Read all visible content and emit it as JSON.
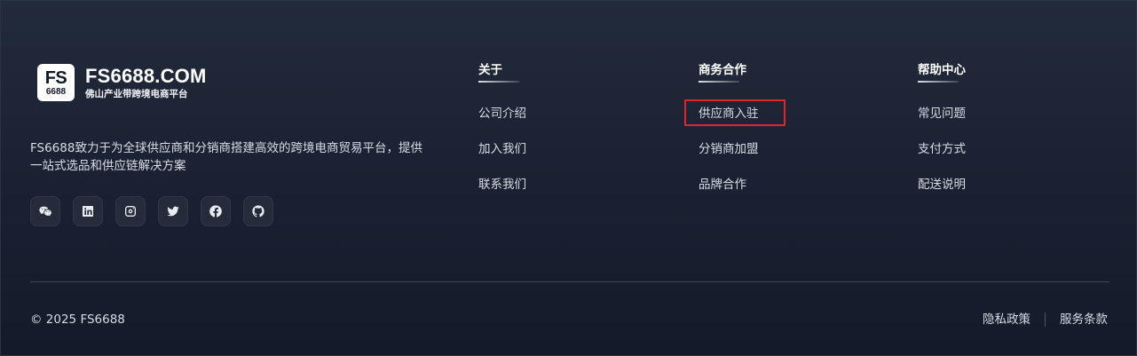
{
  "brand": {
    "logo_line1": "FS",
    "logo_line2": "6688",
    "name": "FS6688.COM",
    "tagline": "佛山产业带跨境电商平台",
    "intro": "FS6688致力于为全球供应商和分销商搭建高效的跨境电商贸易平台，提供一站式选品和供应链解决方案"
  },
  "socials": [
    {
      "icon": "wechat-icon"
    },
    {
      "icon": "linkedin-icon"
    },
    {
      "icon": "instagram-icon"
    },
    {
      "icon": "twitter-icon"
    },
    {
      "icon": "facebook-icon"
    },
    {
      "icon": "github-icon"
    }
  ],
  "columns": [
    {
      "title": "关于",
      "links": [
        "公司介绍",
        "加入我们",
        "联系我们"
      ]
    },
    {
      "title": "商务合作",
      "links": [
        "供应商入驻",
        "分销商加盟",
        "品牌合作"
      ]
    },
    {
      "title": "帮助中心",
      "links": [
        "常见问题",
        "支付方式",
        "配送说明"
      ]
    }
  ],
  "bottom": {
    "copyright": "© 2025 FS6688",
    "privacy": "隐私政策",
    "terms": "服务条款"
  },
  "colors": {
    "background": "#1b2233",
    "highlight_border": "#e0242c"
  }
}
